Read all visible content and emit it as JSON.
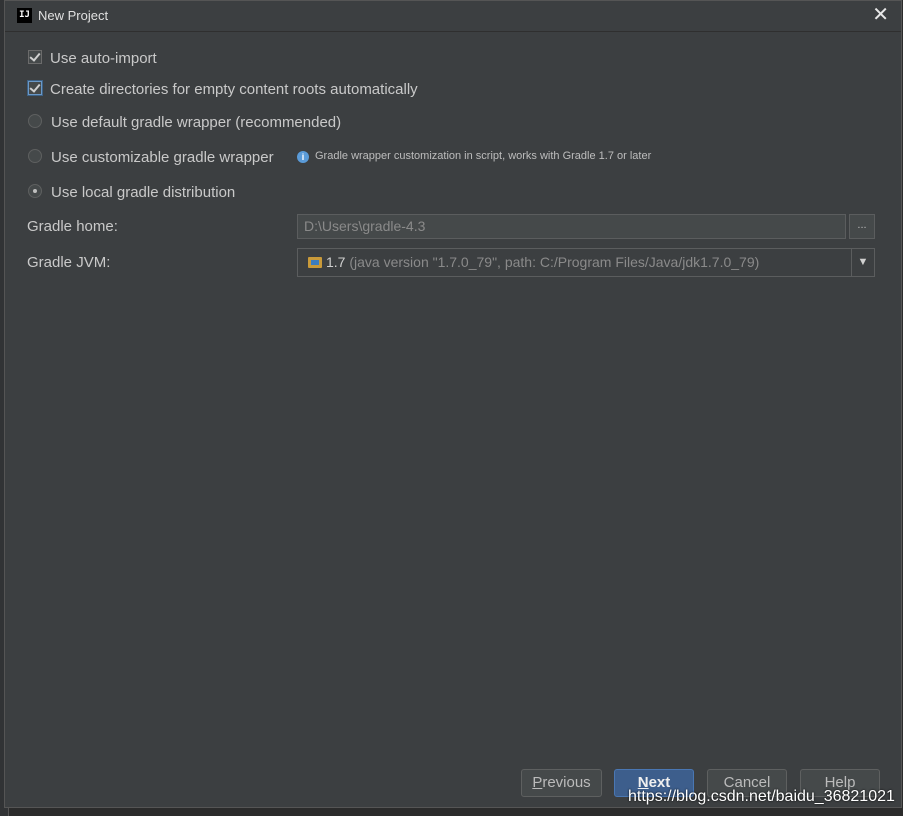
{
  "window": {
    "title": "New Project",
    "app_icon_text": "IJ",
    "close_glyph": "✕"
  },
  "options": {
    "auto_import": {
      "label": "Use auto-import",
      "checked": true
    },
    "create_dirs": {
      "label": "Create directories for empty content roots automatically",
      "checked": true
    },
    "default_wrapper": {
      "label": "Use default gradle wrapper (recommended)",
      "selected": false
    },
    "custom_wrapper": {
      "label": "Use customizable gradle wrapper",
      "selected": false
    },
    "local_distribution": {
      "label": "Use local gradle distribution",
      "selected": true
    }
  },
  "info": {
    "icon": "info-icon",
    "text": "Gradle wrapper customization in script, works with Gradle 1.7 or later"
  },
  "gradle_home": {
    "label": "Gradle home:",
    "value": "D:\\Users\\gradle-4.3",
    "browse_label": "..."
  },
  "gradle_jvm": {
    "label": "Gradle JVM:",
    "version": "1.7",
    "description": "(java version \"1.7.0_79\", path: C:/Program Files/Java/jdk1.7.0_79)",
    "icon": "folder-icon"
  },
  "buttons": {
    "previous_mnemonic": "P",
    "previous_rest": "revious",
    "next_mnemonic": "N",
    "next_rest": "ext",
    "cancel": "Cancel",
    "help": "Help"
  },
  "watermark": "https://blog.csdn.net/baidu_36821021",
  "colors": {
    "background": "#3c3f41",
    "accent": "#3d5e8c",
    "info": "#5a9bd8"
  }
}
